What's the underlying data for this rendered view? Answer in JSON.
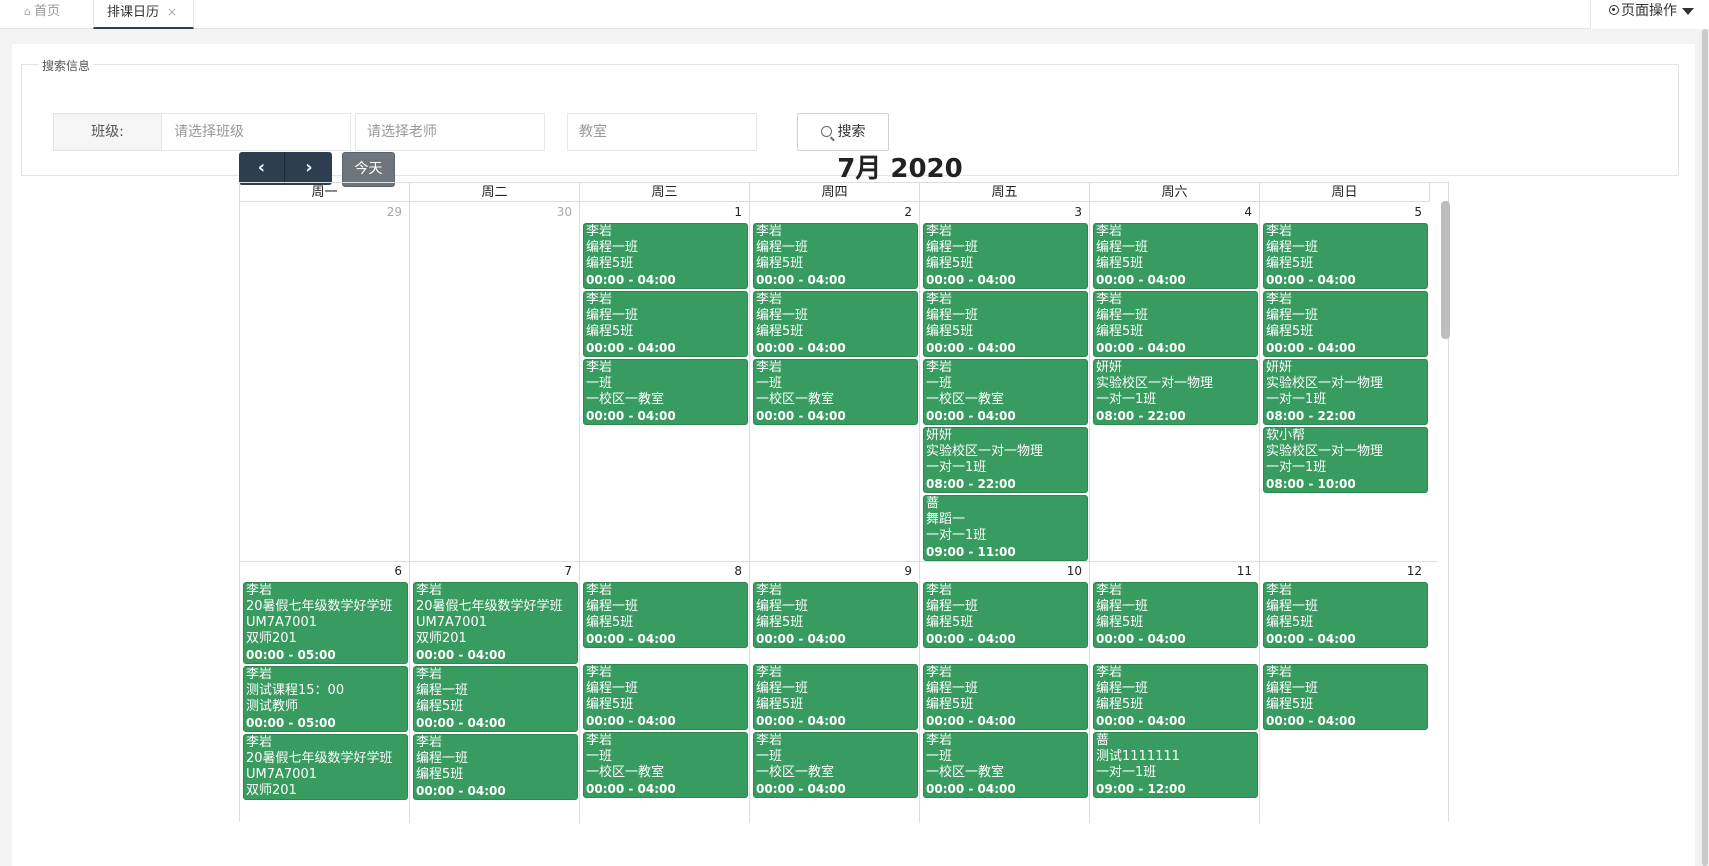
{
  "tabs": {
    "home_label": "首页",
    "active_label": "排课日历",
    "close_glyph": "×",
    "page_ops_label": "页面操作"
  },
  "search": {
    "legend": "搜索信息",
    "class_label": "班级:",
    "class_placeholder": "请选择班级",
    "teacher_placeholder": "请选择老师",
    "room_placeholder": "教室",
    "search_label": "搜索"
  },
  "toolbar": {
    "prev_glyph": "‹",
    "next_glyph": "›",
    "today_label": "今天",
    "title": "7月 2020"
  },
  "colors": {
    "event_bg": "#389b5f",
    "nav_bg": "#2c3e50",
    "today_bg": "#6f757c"
  },
  "calendar": {
    "weekdays": [
      "周一",
      "周二",
      "周三",
      "周四",
      "周五",
      "周六",
      "周日"
    ],
    "weeks": [
      {
        "days": [
          {
            "num": "29",
            "other": true,
            "events": []
          },
          {
            "num": "30",
            "other": true,
            "events": []
          },
          {
            "num": "1",
            "other": false,
            "events": [
              {
                "lines": [
                  "李岩",
                  "编程一班",
                  "编程5班"
                ],
                "time": "00:00 - 04:00"
              },
              {
                "lines": [
                  "李岩",
                  "编程一班",
                  "编程5班"
                ],
                "time": "00:00 - 04:00"
              },
              {
                "lines": [
                  "李岩",
                  "一班",
                  "一校区一教室"
                ],
                "time": "00:00 - 04:00"
              }
            ]
          },
          {
            "num": "2",
            "other": false,
            "events": [
              {
                "lines": [
                  "李岩",
                  "编程一班",
                  "编程5班"
                ],
                "time": "00:00 - 04:00"
              },
              {
                "lines": [
                  "李岩",
                  "编程一班",
                  "编程5班"
                ],
                "time": "00:00 - 04:00"
              },
              {
                "lines": [
                  "李岩",
                  "一班",
                  "一校区一教室"
                ],
                "time": "00:00 - 04:00"
              }
            ]
          },
          {
            "num": "3",
            "other": false,
            "events": [
              {
                "lines": [
                  "李岩",
                  "编程一班",
                  "编程5班"
                ],
                "time": "00:00 - 04:00"
              },
              {
                "lines": [
                  "李岩",
                  "编程一班",
                  "编程5班"
                ],
                "time": "00:00 - 04:00"
              },
              {
                "lines": [
                  "李岩",
                  "一班",
                  "一校区一教室"
                ],
                "time": "00:00 - 04:00"
              },
              {
                "lines": [
                  "妍妍",
                  "实验校区一对一物理",
                  "一对一1班"
                ],
                "time": "08:00 - 22:00"
              },
              {
                "lines": [
                  "蔷",
                  "舞蹈一",
                  "一对一1班"
                ],
                "time": "09:00 - 11:00"
              }
            ]
          },
          {
            "num": "4",
            "other": false,
            "events": [
              {
                "lines": [
                  "李岩",
                  "编程一班",
                  "编程5班"
                ],
                "time": "00:00 - 04:00"
              },
              {
                "lines": [
                  "李岩",
                  "编程一班",
                  "编程5班"
                ],
                "time": "00:00 - 04:00"
              },
              {
                "lines": [
                  "妍妍",
                  "实验校区一对一物理",
                  "一对一1班"
                ],
                "time": "08:00 - 22:00"
              }
            ]
          },
          {
            "num": "5",
            "other": false,
            "events": [
              {
                "lines": [
                  "李岩",
                  "编程一班",
                  "编程5班"
                ],
                "time": "00:00 - 04:00"
              },
              {
                "lines": [
                  "李岩",
                  "编程一班",
                  "编程5班"
                ],
                "time": "00:00 - 04:00"
              },
              {
                "lines": [
                  "妍妍",
                  "实验校区一对一物理",
                  "一对一1班"
                ],
                "time": "08:00 - 22:00"
              },
              {
                "lines": [
                  "软小帮",
                  "实验校区一对一物理",
                  "一对一1班"
                ],
                "time": "08:00 - 10:00"
              }
            ]
          }
        ]
      },
      {
        "days": [
          {
            "num": "6",
            "other": false,
            "events": [
              {
                "lines": [
                  "李岩",
                  "20暑假七年级数学好学班",
                  "UM7A7001",
                  "双师201"
                ],
                "time": "00:00 - 05:00"
              },
              {
                "lines": [
                  "李岩",
                  "测试课程15：00",
                  "测试教师"
                ],
                "time": "00:00 - 05:00"
              },
              {
                "lines": [
                  "李岩",
                  "20暑假七年级数学好学班",
                  "UM7A7001",
                  "双师201"
                ],
                "time": ""
              }
            ]
          },
          {
            "num": "7",
            "other": false,
            "events": [
              {
                "lines": [
                  "李岩",
                  "20暑假七年级数学好学班",
                  "UM7A7001",
                  "双师201"
                ],
                "time": "00:00 - 04:00"
              },
              {
                "lines": [
                  "李岩",
                  "编程一班",
                  "编程5班"
                ],
                "time": "00:00 - 04:00"
              },
              {
                "lines": [
                  "李岩",
                  "编程一班",
                  "编程5班"
                ],
                "time": "00:00 - 04:00"
              }
            ]
          },
          {
            "num": "8",
            "other": false,
            "events": [
              {
                "lines": [
                  "李岩",
                  "编程一班",
                  "编程5班"
                ],
                "time": "00:00 - 04:00"
              },
              {
                "lines": [
                  "李岩",
                  "编程一班",
                  "编程5班"
                ],
                "time": "00:00 - 04:00"
              },
              {
                "lines": [
                  "李岩",
                  "一班",
                  "一校区一教室"
                ],
                "time": "00:00 - 04:00"
              }
            ]
          },
          {
            "num": "9",
            "other": false,
            "events": [
              {
                "lines": [
                  "李岩",
                  "编程一班",
                  "编程5班"
                ],
                "time": "00:00 - 04:00"
              },
              {
                "lines": [
                  "李岩",
                  "编程一班",
                  "编程5班"
                ],
                "time": "00:00 - 04:00"
              },
              {
                "lines": [
                  "李岩",
                  "一班",
                  "一校区一教室"
                ],
                "time": "00:00 - 04:00"
              }
            ]
          },
          {
            "num": "10",
            "other": false,
            "events": [
              {
                "lines": [
                  "李岩",
                  "编程一班",
                  "编程5班"
                ],
                "time": "00:00 - 04:00"
              },
              {
                "lines": [
                  "李岩",
                  "编程一班",
                  "编程5班"
                ],
                "time": "00:00 - 04:00"
              },
              {
                "lines": [
                  "李岩",
                  "一班",
                  "一校区一教室"
                ],
                "time": "00:00 - 04:00"
              }
            ]
          },
          {
            "num": "11",
            "other": false,
            "events": [
              {
                "lines": [
                  "李岩",
                  "编程一班",
                  "编程5班"
                ],
                "time": "00:00 - 04:00"
              },
              {
                "lines": [
                  "李岩",
                  "编程一班",
                  "编程5班"
                ],
                "time": "00:00 - 04:00"
              },
              {
                "lines": [
                  "蔷",
                  "测试1111111",
                  "一对一1班"
                ],
                "time": "09:00 - 12:00"
              }
            ]
          },
          {
            "num": "12",
            "other": false,
            "events": [
              {
                "lines": [
                  "李岩",
                  "编程一班",
                  "编程5班"
                ],
                "time": "00:00 - 04:00"
              },
              {
                "lines": [
                  "李岩",
                  "编程一班",
                  "编程5班"
                ],
                "time": "00:00 - 04:00"
              }
            ]
          }
        ]
      }
    ]
  }
}
